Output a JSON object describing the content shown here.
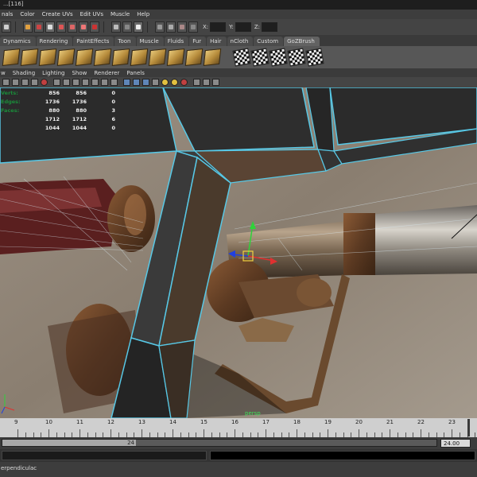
{
  "window": {
    "title": "...[116]"
  },
  "menu": {
    "items": [
      "nals",
      "Color",
      "Create UVs",
      "Edit UVs",
      "Muscle",
      "Help"
    ]
  },
  "status_line": {
    "x_label": "X:",
    "y_label": "Y:",
    "z_label": "Z:"
  },
  "shelf_tabs": {
    "items": [
      "Dynamics",
      "Rendering",
      "PaintEffects",
      "Toon",
      "Muscle",
      "Fluids",
      "Fur",
      "Hair",
      "nCloth",
      "Custom",
      "GoZBrush"
    ],
    "active": "GoZBrush"
  },
  "panel_menu": {
    "items": [
      "w",
      "Shading",
      "Lighting",
      "Show",
      "Renderer",
      "Panels"
    ]
  },
  "hud": {
    "rows": [
      {
        "label": "Verts:",
        "a": "856",
        "b": "856",
        "c": "0"
      },
      {
        "label": "Edges:",
        "a": "1736",
        "b": "1736",
        "c": "0"
      },
      {
        "label": "Faces:",
        "a": "880",
        "b": "880",
        "c": "3"
      },
      {
        "label": "",
        "a": "1712",
        "b": "1712",
        "c": "6"
      },
      {
        "label": "",
        "a": "1044",
        "b": "1044",
        "c": "0"
      }
    ]
  },
  "viewport": {
    "camera": "persp"
  },
  "time_slider": {
    "ticks": [
      "9",
      "10",
      "11",
      "12",
      "13",
      "14",
      "15",
      "16",
      "17",
      "18",
      "19",
      "20",
      "21",
      "22",
      "23"
    ]
  },
  "range_slider": {
    "handle_label": "24",
    "end_value": "24.00"
  },
  "help_line": {
    "text": "erpendiculac"
  },
  "colors": {
    "wireframe": "#57c8e6",
    "hud_label": "#1a8c3a",
    "manipulator_y": "#2fd23a",
    "manipulator_x": "#e03030",
    "manipulator_z": "#2040e0"
  }
}
